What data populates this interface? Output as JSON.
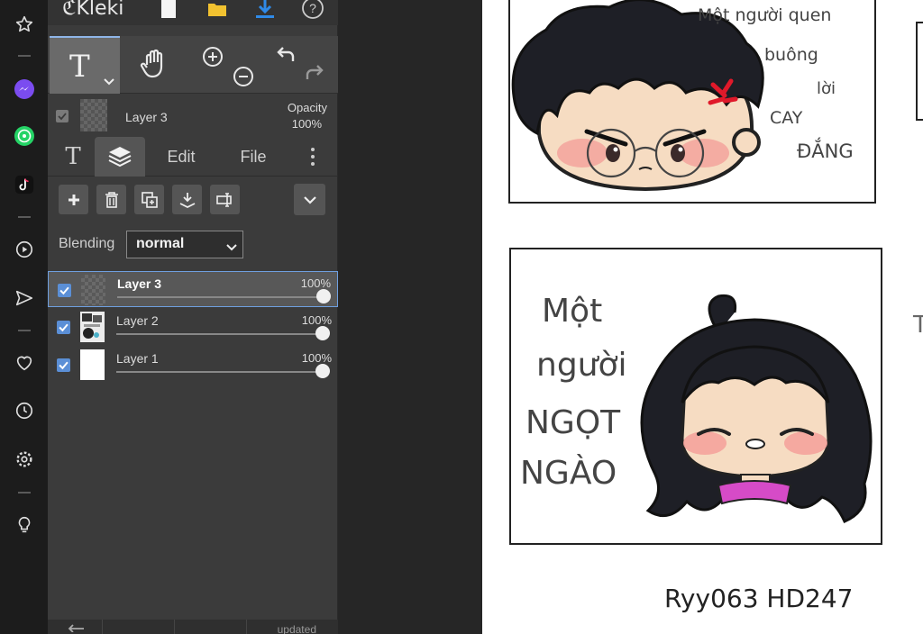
{
  "app": {
    "name": "Kleki"
  },
  "tools": {
    "active": "T"
  },
  "layer_header": {
    "name": "Layer 3",
    "opacity_label": "Opacity",
    "opacity_value": "100%"
  },
  "tabs": {
    "text": "T",
    "edit": "Edit",
    "file": "File"
  },
  "blending": {
    "label": "Blending",
    "value": "normal"
  },
  "layers": [
    {
      "name": "Layer 3",
      "opacity": "100%",
      "opacity_value": 1.0,
      "checked": true,
      "active": true
    },
    {
      "name": "Layer 2",
      "opacity": "100%",
      "opacity_value": 1.0,
      "checked": true,
      "active": false
    },
    {
      "name": "Layer 1",
      "opacity": "100%",
      "opacity_value": 1.0,
      "checked": true,
      "active": false
    }
  ],
  "status": {
    "updated": "updated"
  },
  "canvas": {
    "panel1_text": [
      "Một người quen",
      "buông",
      "lời",
      "CAY",
      "ĐẮNG"
    ],
    "panel2_text": [
      "Một",
      "người",
      "NGỌT",
      "NGÀO"
    ],
    "signature": "Ryy063 HD247",
    "right_edge_char": "T"
  },
  "colors": {
    "accent": "#5b8fd6",
    "active_outline": "#6f9fe0",
    "panel_bg": "#3b3b3b",
    "sidebar_bg": "#1c1c1c",
    "messenger": "#7b4cf0",
    "whatsapp": "#25d366"
  }
}
